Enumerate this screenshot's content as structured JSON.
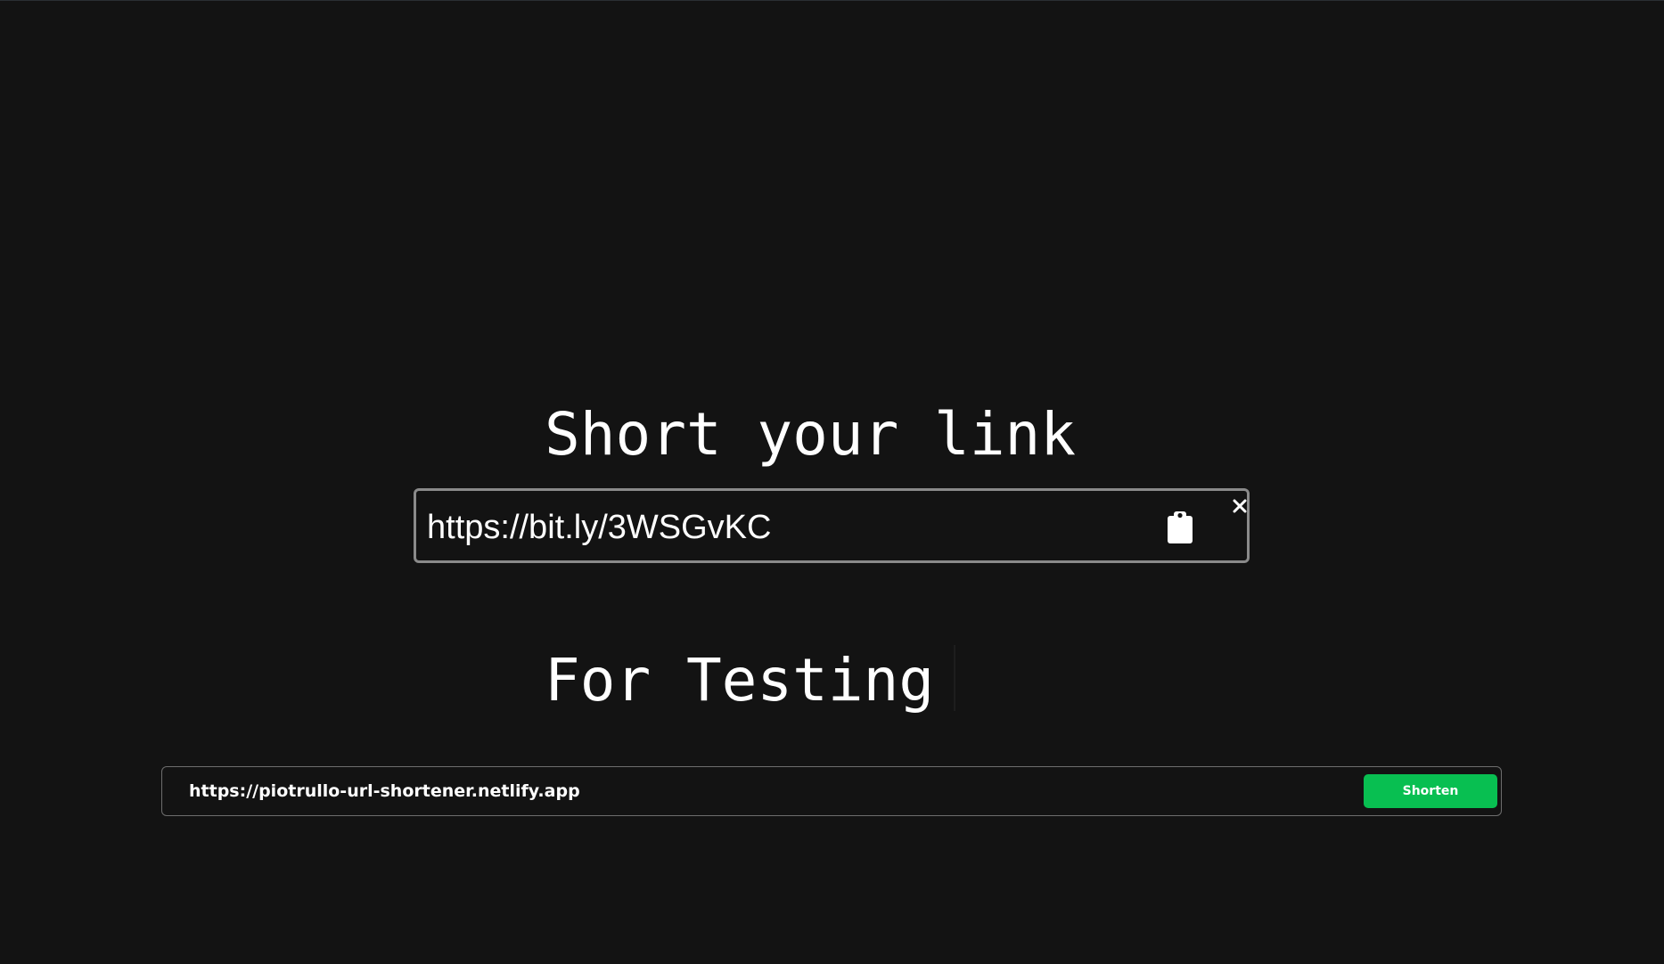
{
  "hero": {
    "line1": "Short your link",
    "line2": "For Testing"
  },
  "result": {
    "short_url": "https://bit.ly/3WSGvKC",
    "copy_icon": "clipboard-icon",
    "close_icon": "close-icon"
  },
  "form": {
    "url_value": "https://piotrullo-url-shortener.netlify.app",
    "submit_label": "Shorten"
  },
  "colors": {
    "background": "#131313",
    "accent": "#08bf51",
    "text": "#ffffff",
    "border": "#8a8a8a"
  }
}
